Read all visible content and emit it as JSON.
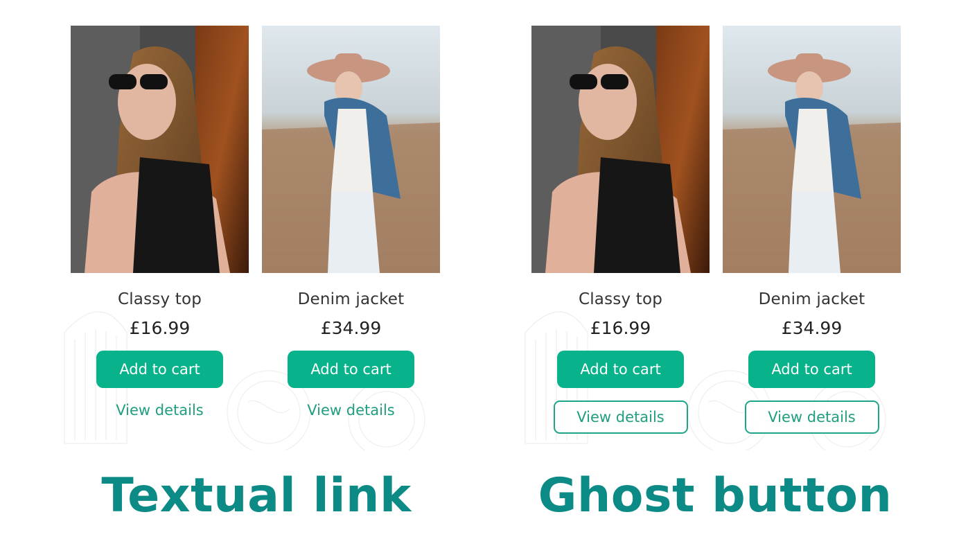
{
  "panels": [
    {
      "caption": "Textual link",
      "products": [
        {
          "name": "Classy top",
          "price": "£16.99",
          "cart_label": "Add to cart",
          "details_label": "View details"
        },
        {
          "name": "Denim jacket",
          "price": "£34.99",
          "cart_label": "Add to cart",
          "details_label": "View details"
        }
      ]
    },
    {
      "caption": "Ghost button",
      "products": [
        {
          "name": "Classy top",
          "price": "£16.99",
          "cart_label": "Add to cart",
          "details_label": "View details"
        },
        {
          "name": "Denim jacket",
          "price": "£34.99",
          "cart_label": "Add to cart",
          "details_label": "View details"
        }
      ]
    }
  ],
  "colors": {
    "accent": "#08b28a",
    "link": "#1f9e80",
    "caption": "#0b8a86"
  }
}
